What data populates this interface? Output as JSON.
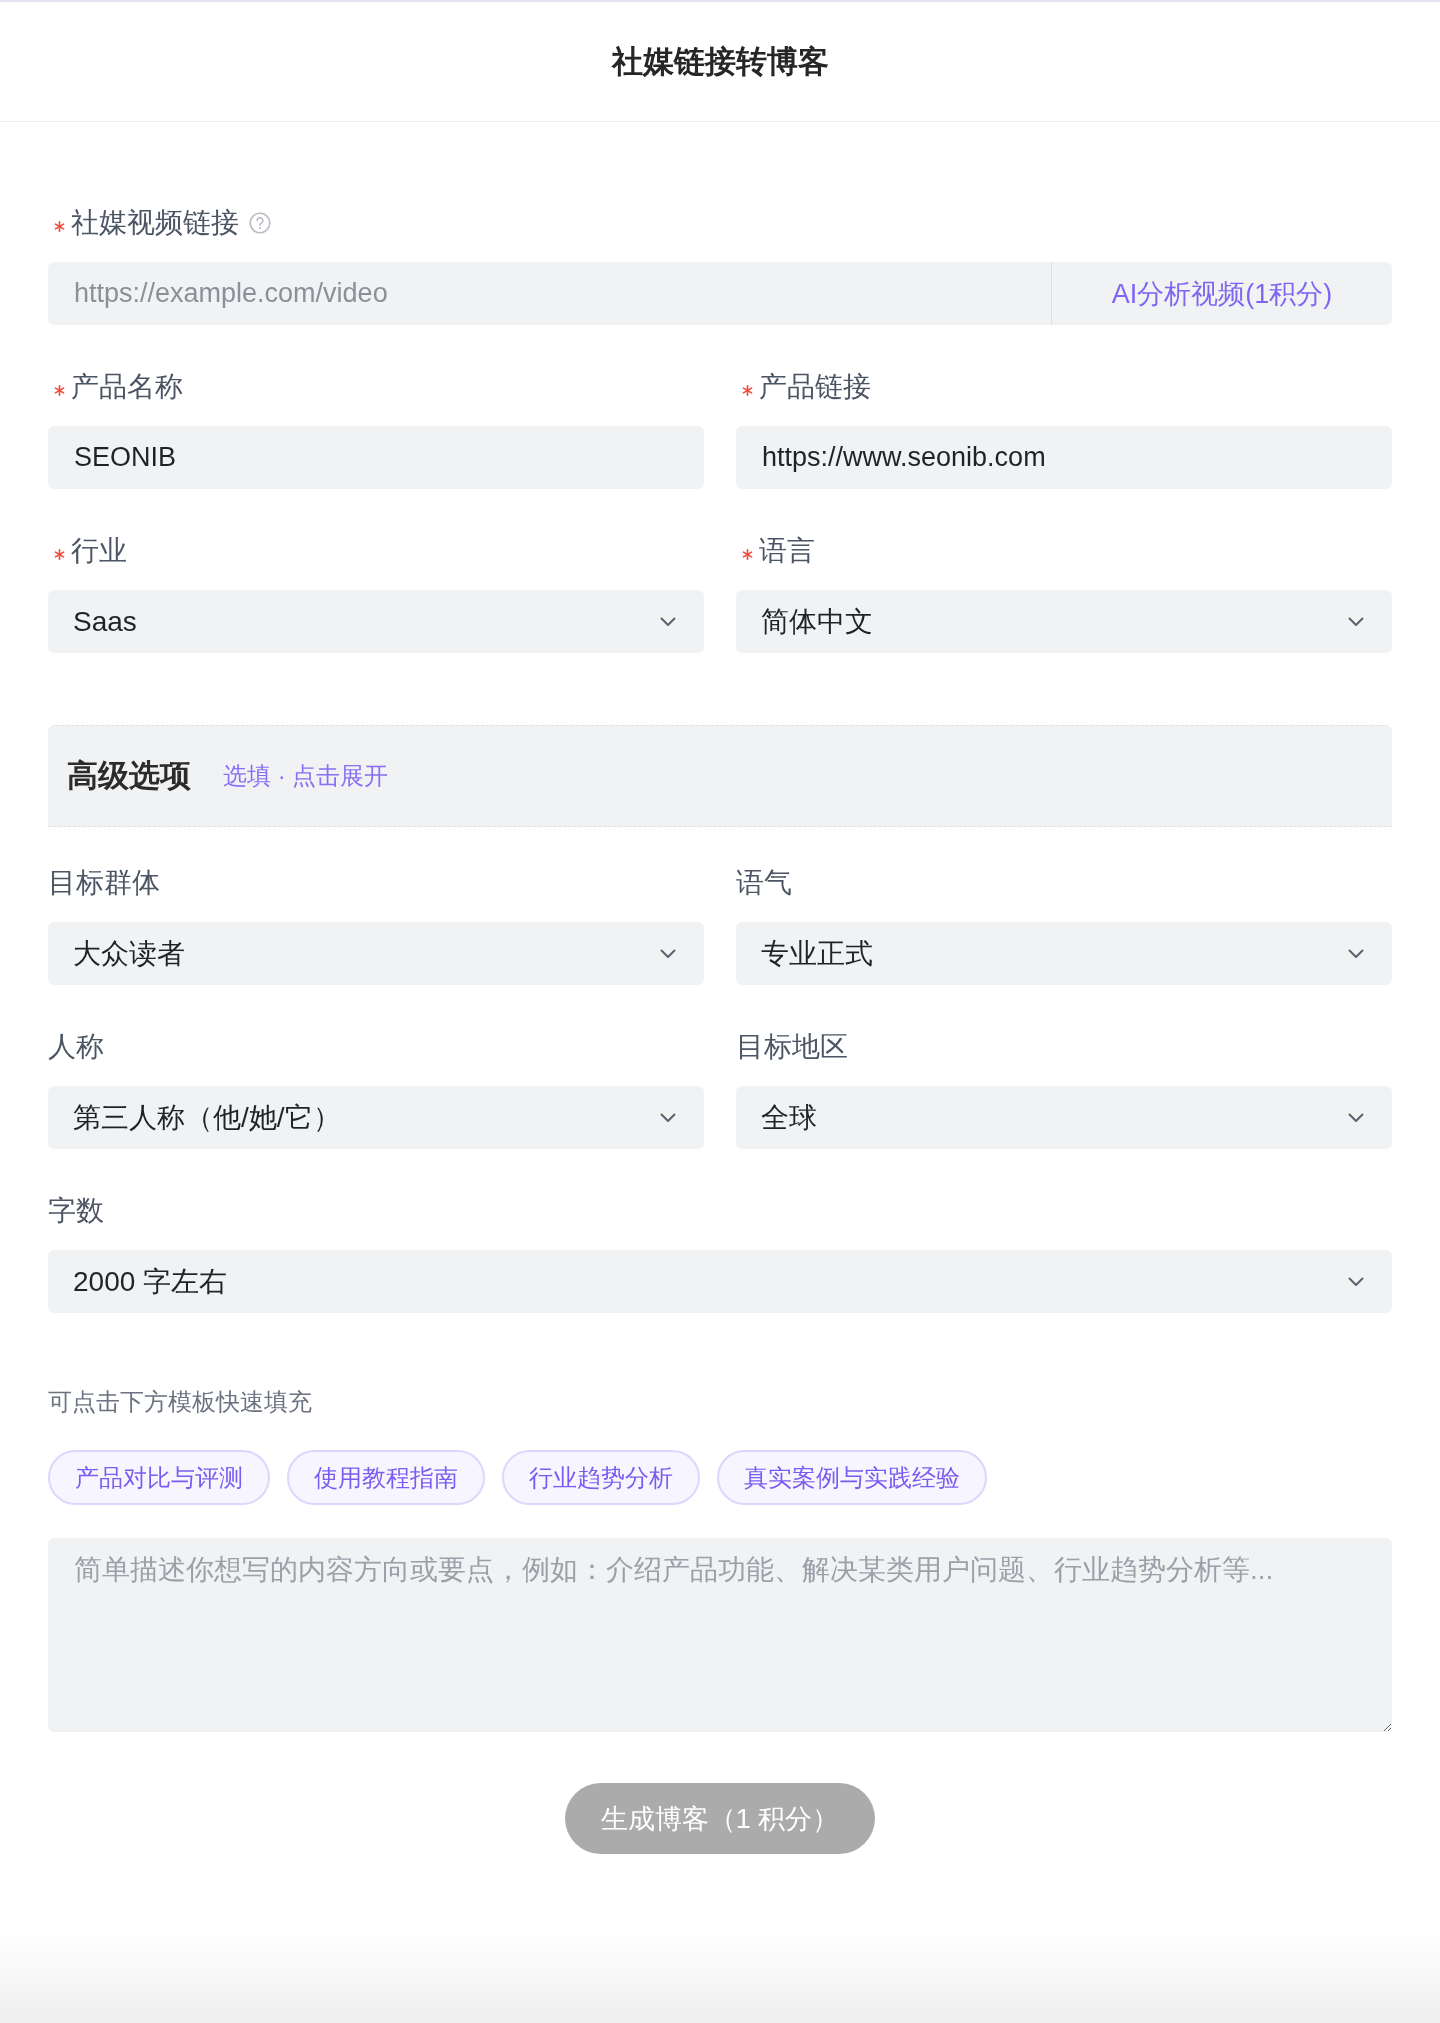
{
  "header": {
    "title": "社媒链接转博客"
  },
  "video_link": {
    "label": "社媒视频链接",
    "required": true,
    "help": true,
    "placeholder": "https://example.com/video",
    "button": "AI分析视频(1积分)"
  },
  "basic_fields": [
    {
      "label": "产品名称",
      "required": true,
      "kind": "input",
      "value": "SEONIB"
    },
    {
      "label": "产品链接",
      "required": true,
      "kind": "input",
      "value": "https://www.seonib.com"
    },
    {
      "label": "行业",
      "required": true,
      "kind": "select",
      "value": "Saas"
    },
    {
      "label": "语言",
      "required": true,
      "kind": "select",
      "value": "简体中文"
    }
  ],
  "advanced": {
    "title": "高级选项",
    "hint": "选填 · 点击展开"
  },
  "advanced_fields": [
    {
      "label": "目标群体",
      "required": false,
      "kind": "select",
      "value": "大众读者"
    },
    {
      "label": "语气",
      "required": false,
      "kind": "select",
      "value": "专业正式"
    },
    {
      "label": "人称",
      "required": false,
      "kind": "select",
      "value": "第三人称（他/她/它）"
    },
    {
      "label": "目标地区",
      "required": false,
      "kind": "select",
      "value": "全球"
    },
    {
      "label": "字数",
      "required": false,
      "kind": "select",
      "value": "2000 字左右"
    }
  ],
  "templates": {
    "hint": "可点击下方模板快速填充",
    "chips": [
      "产品对比与评测",
      "使用教程指南",
      "行业趋势分析",
      "真实案例与实践经验"
    ]
  },
  "description": {
    "placeholder": "简单描述你想写的内容方向或要点，例如：介绍产品功能、解决某类用户问题、行业趋势分析等..."
  },
  "submit": {
    "label": "生成博客（1 积分）",
    "disabled": true
  }
}
